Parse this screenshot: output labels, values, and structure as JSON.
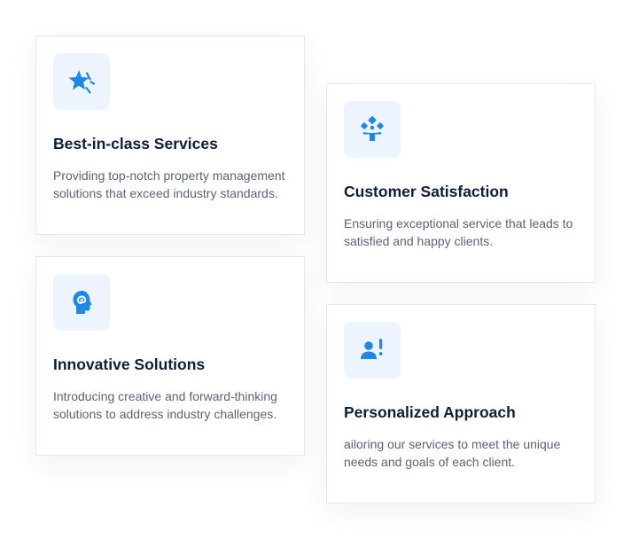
{
  "colors": {
    "accent": "#1e88e5",
    "icon_bg": "#eef4fe",
    "title": "#0f1f33",
    "text": "#5a6472",
    "border": "#e6e8ec"
  },
  "cards": [
    {
      "icon": "star-icon",
      "title": "Best-in-class Services",
      "description": "Providing top-notch property management solutions that exceed industry standards."
    },
    {
      "icon": "satisfaction-icon",
      "title": "Customer Satisfaction",
      "description": "Ensuring exceptional service that leads to satisfied and happy clients."
    },
    {
      "icon": "idea-head-icon",
      "title": "Innovative Solutions",
      "description": "Introducing creative and forward-thinking solutions to address industry challenges."
    },
    {
      "icon": "person-alert-icon",
      "title": "Personalized Approach",
      "description": "ailoring our services to meet the unique needs and goals of each client."
    }
  ]
}
